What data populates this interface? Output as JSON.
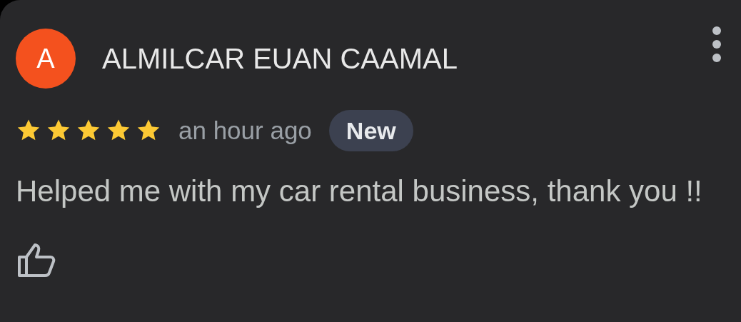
{
  "review": {
    "avatar_letter": "A",
    "author": "ALMILCAR EUAN CAAMAL",
    "stars": 5,
    "time": "an hour ago",
    "badge": "New",
    "text": "Helped me with my car rental business, thank you !!"
  }
}
